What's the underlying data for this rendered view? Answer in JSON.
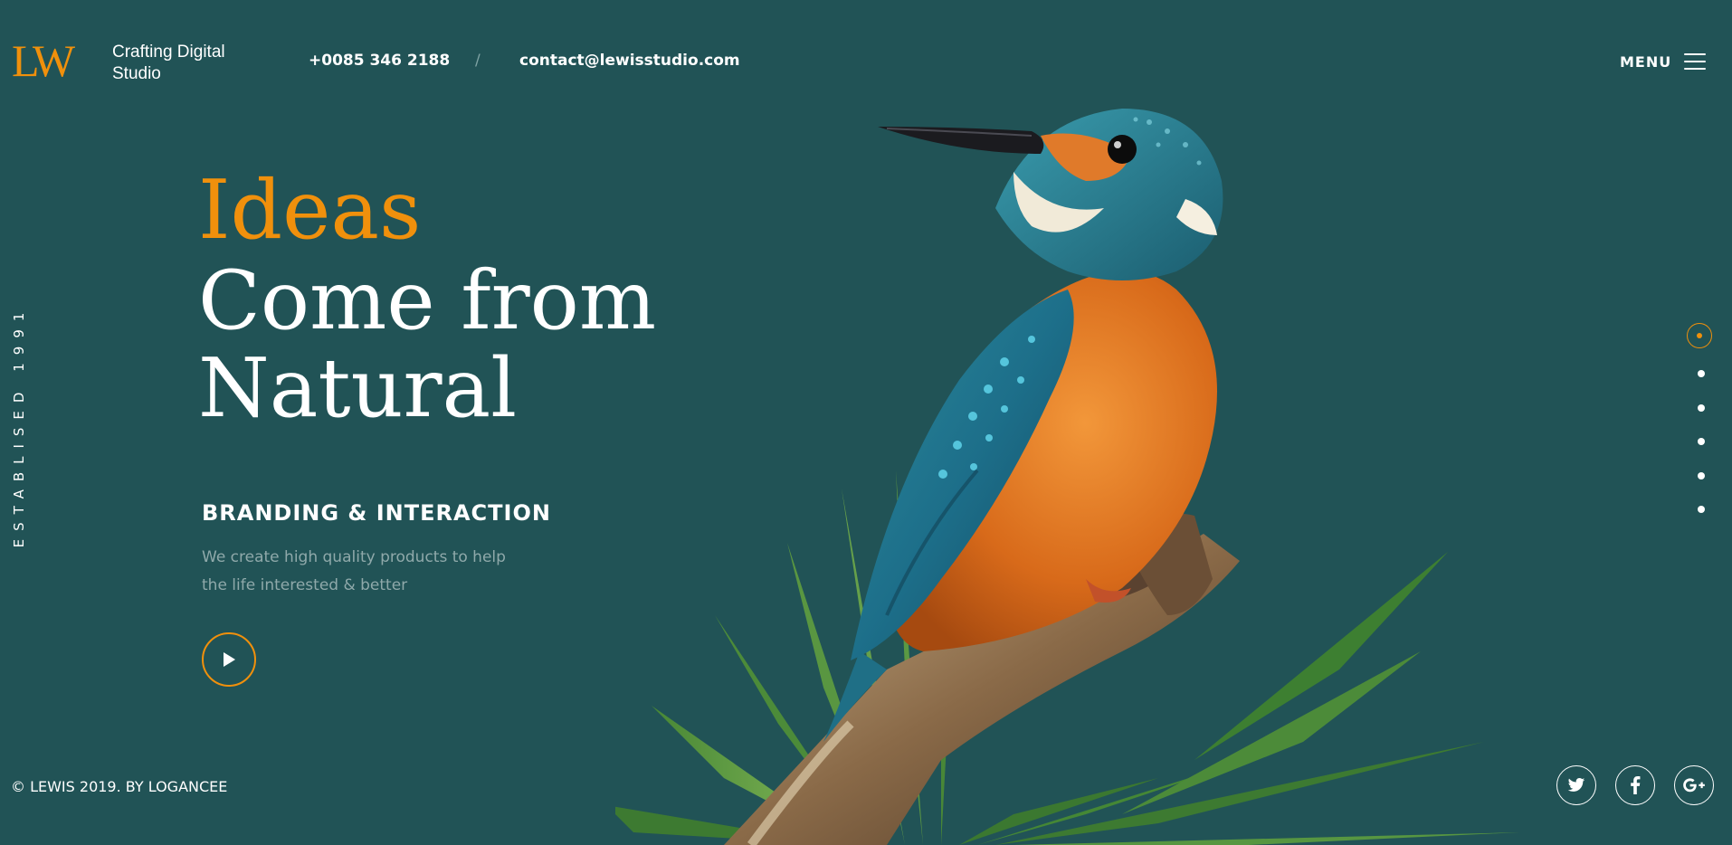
{
  "header": {
    "logo_mark": "LW",
    "logo_text": "Crafting Digital Studio",
    "phone": "+0085 346 2188",
    "separator": "/",
    "email": "contact@lewisstudio.com",
    "menu_label": "MENU"
  },
  "side": {
    "established": "ESTABLISED 1991"
  },
  "hero": {
    "line1": "Ideas",
    "line2": "Come from",
    "line3": "Natural",
    "subtitle": "BRANDING & INTERACTION",
    "description": "We create high quality products to help the life interested & better"
  },
  "slider": {
    "total": 6,
    "active_index": 1
  },
  "footer": {
    "copyright": "© LEWIS 2019.  BY LOGANCEE",
    "social": [
      "twitter-icon",
      "facebook-icon",
      "google-plus-icon"
    ]
  },
  "colors": {
    "background": "#215356",
    "accent": "#f0900c",
    "text": "#ffffff",
    "muted": "#8fa9aa"
  }
}
